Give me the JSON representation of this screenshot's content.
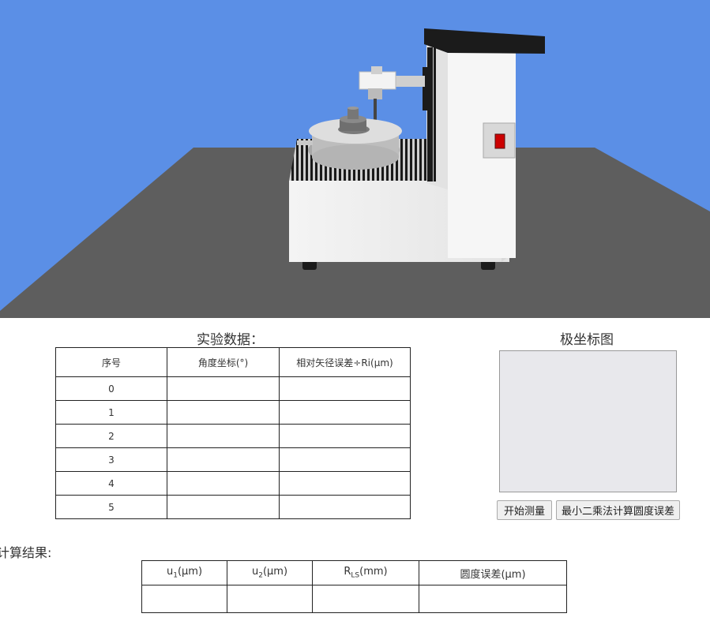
{
  "experiment": {
    "title": "实验数据：",
    "headers": [
      "序号",
      "角度坐标(°)",
      "相对矢径误差÷Ri(μm)"
    ],
    "rows": [
      {
        "index": "0",
        "angle": "",
        "error": ""
      },
      {
        "index": "1",
        "angle": "",
        "error": ""
      },
      {
        "index": "2",
        "angle": "",
        "error": ""
      },
      {
        "index": "3",
        "angle": "",
        "error": ""
      },
      {
        "index": "4",
        "angle": "",
        "error": ""
      },
      {
        "index": "5",
        "angle": "",
        "error": ""
      }
    ]
  },
  "polar": {
    "title": "极坐标图",
    "start_button": "开始测量",
    "calc_button": "最小二乘法计算圆度误差"
  },
  "results": {
    "title": "计算结果:",
    "headers": {
      "u1": {
        "base": "u",
        "sub": "1",
        "unit": "(μm)"
      },
      "u2": {
        "base": "u",
        "sub": "2",
        "unit": "(μm)"
      },
      "rls": {
        "base": "R",
        "sub": "LS",
        "unit": "(mm)"
      },
      "roundness": "圆度误差(μm)"
    },
    "values": [
      "",
      "",
      "",
      ""
    ]
  },
  "colors": {
    "sky": "#5b8fe6",
    "floor": "#5e5e5e",
    "panel_bg": "#e8e8ec",
    "indicator": "#cc0000"
  }
}
